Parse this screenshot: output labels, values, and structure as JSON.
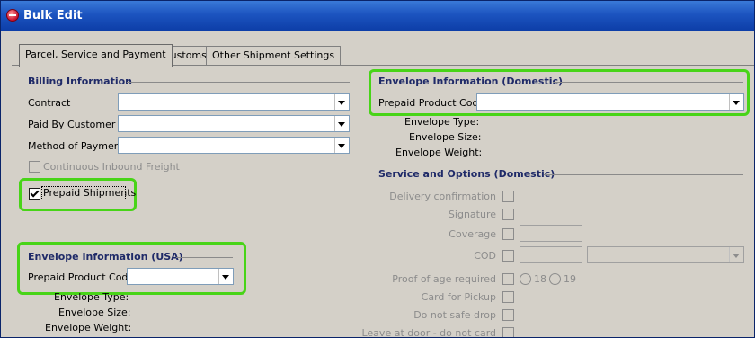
{
  "window": {
    "title": "Bulk Edit"
  },
  "tabs": [
    {
      "label": "Parcel, Service and Payment",
      "active": true
    },
    {
      "label": "Customs",
      "active": false
    },
    {
      "label": "Other Shipment Settings",
      "active": false
    }
  ],
  "billing": {
    "header": "Billing Information",
    "contract_label": "Contract",
    "contract_value": "",
    "paid_by_label": "Paid By Customer",
    "paid_by_value": "",
    "method_label": "Method of Payment",
    "method_value": "",
    "continuous_label": "Continuous Inbound Freight",
    "continuous_checked": false,
    "prepaid_shipments_label": "Prepaid Shipments",
    "prepaid_shipments_checked": true
  },
  "envelope_usa": {
    "header": "Envelope Information (USA)",
    "product_code_label": "Prepaid Product Code",
    "product_code_value": "",
    "type_label": "Envelope Type:",
    "size_label": "Envelope Size:",
    "weight_label": "Envelope Weight:"
  },
  "envelope_domestic": {
    "header": "Envelope Information (Domestic)",
    "product_code_label": "Prepaid Product Code",
    "product_code_value": "",
    "type_label": "Envelope Type:",
    "size_label": "Envelope Size:",
    "weight_label": "Envelope Weight:"
  },
  "service_domestic": {
    "header": "Service and Options (Domestic)",
    "delivery_confirmation": "Delivery confirmation",
    "signature": "Signature",
    "coverage": "Coverage",
    "cod": "COD",
    "proof_of_age": "Proof of age required",
    "age_18": "18",
    "age_19": "19",
    "card_for_pickup": "Card for Pickup",
    "do_not_safe_drop": "Do not safe drop",
    "leave_at_door": "Leave at door - do not card"
  },
  "colors": {
    "highlight": "#48d418",
    "header_text": "#1f2a68",
    "title_bar": "#1c54c0"
  }
}
